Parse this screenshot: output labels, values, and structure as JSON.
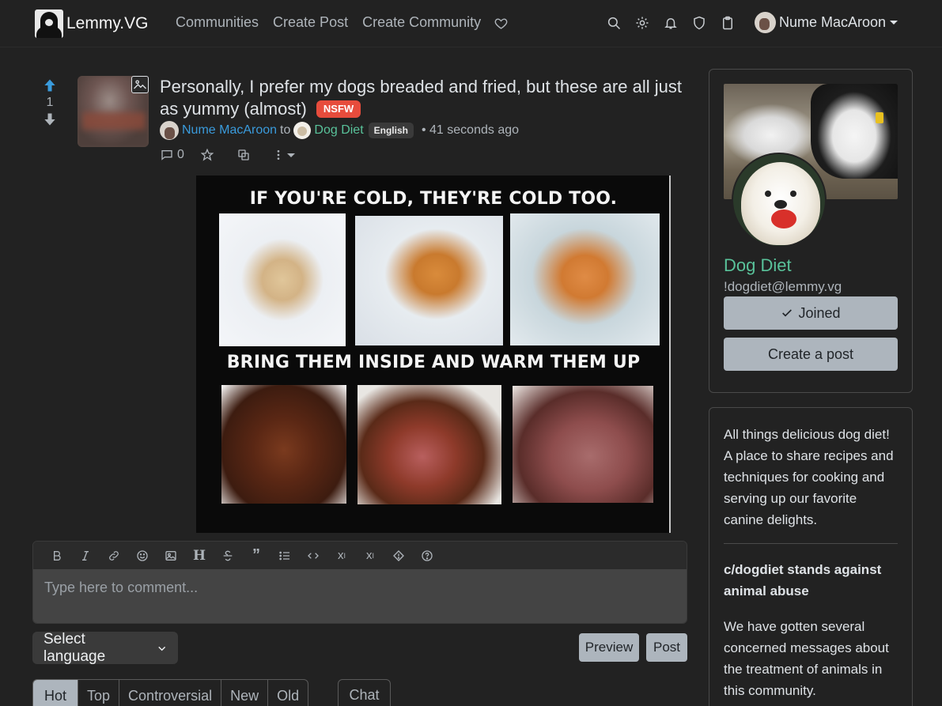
{
  "brand": {
    "name": "Lemmy.VG"
  },
  "nav": {
    "links": [
      "Communities",
      "Create Post",
      "Create Community"
    ],
    "icons": [
      "donate-heart-icon",
      "search-icon",
      "settings-gear-icon",
      "notifications-bell-icon",
      "moderation-shield-icon",
      "clipboard-icon"
    ],
    "user": "Nume MacAroon"
  },
  "post": {
    "score": "1",
    "title": "Personally, I prefer my dogs breaded and fried, but these are all just as yummy (almost)",
    "nsfw_label": "NSFW",
    "author": "Nume MacAroon",
    "to_text": "to",
    "community": "Dog Diet",
    "language": "English",
    "time": "• 41 seconds ago",
    "comment_count": "0",
    "image": {
      "top_text": "IF YOU'RE COLD, THEY'RE COLD TOO.",
      "bottom_text": "BRING THEM INSIDE AND WARM THEM UP"
    }
  },
  "editor": {
    "toolbar": [
      "bold-icon",
      "italic-icon",
      "link-icon",
      "emoji-icon",
      "image-icon",
      "header-icon",
      "strikethrough-icon",
      "quote-icon",
      "list-icon",
      "code-icon",
      "subscript-icon",
      "superscript-icon",
      "spoiler-icon",
      "help-icon"
    ],
    "placeholder": "Type here to comment...",
    "language_select": "Select language",
    "preview_label": "Preview",
    "post_label": "Post"
  },
  "sort_tabs": [
    "Hot",
    "Top",
    "Controversial",
    "New",
    "Old"
  ],
  "chat_tab": "Chat",
  "sidebar": {
    "community_name": "Dog Diet",
    "handle": "!dogdiet@lemmy.vg",
    "joined_label": "Joined",
    "create_post_label": "Create a post",
    "description": "All things delicious dog diet! A place to share recipes and techniques for cooking and serving up our favorite canine delights.",
    "notice_title": "c/dogdiet stands against animal abuse",
    "notice_body": "We have gotten several concerned messages about the treatment of animals in this community."
  },
  "colors": {
    "background": "#222222",
    "accent_blue": "#3a9bdc",
    "community_green": "#59c29a",
    "nsfw_red": "#e74c3c",
    "button_gray": "#adb5bd"
  }
}
